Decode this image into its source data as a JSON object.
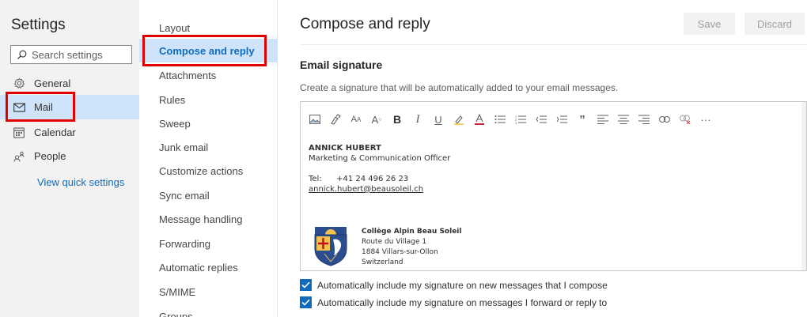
{
  "settings": {
    "title": "Settings",
    "search_placeholder": "Search settings",
    "nav": [
      {
        "label": "General",
        "icon": "gear-icon"
      },
      {
        "label": "Mail",
        "icon": "mail-icon",
        "selected": true
      },
      {
        "label": "Calendar",
        "icon": "calendar-icon"
      },
      {
        "label": "People",
        "icon": "people-icon"
      }
    ],
    "quick_link": "View quick settings"
  },
  "submenu": {
    "items": [
      "Layout",
      "Compose and reply",
      "Attachments",
      "Rules",
      "Sweep",
      "Junk email",
      "Customize actions",
      "Sync email",
      "Message handling",
      "Forwarding",
      "Automatic replies",
      "S/MIME",
      "Groups"
    ],
    "selected_index": 1
  },
  "page": {
    "title": "Compose and reply",
    "save_label": "Save",
    "discard_label": "Discard",
    "section_title": "Email signature",
    "section_desc": "Create a signature that will be automatically added to your email messages."
  },
  "toolbar": {
    "more_label": "···"
  },
  "signature": {
    "name": "ANNICK HUBERT",
    "role": "Marketing & Communication Officer",
    "tel_label": "Tel:",
    "tel": "+41 24 496 26 23",
    "email": "annick.hubert@beausoleil.ch",
    "institution": {
      "name": "Collège Alpin Beau Soleil",
      "address1": "Route du Village 1",
      "address2": "1884 Villars-sur-Ollon",
      "country": "Switzerland"
    }
  },
  "options": [
    {
      "label": "Automatically include my signature on new messages that I compose",
      "checked": true
    },
    {
      "label": "Automatically include my signature on messages I forward or reply to",
      "checked": true
    }
  ],
  "colors": {
    "accent": "#0f6cbd",
    "selected_bg": "#cfe4fa",
    "highlight": "#e00000"
  }
}
